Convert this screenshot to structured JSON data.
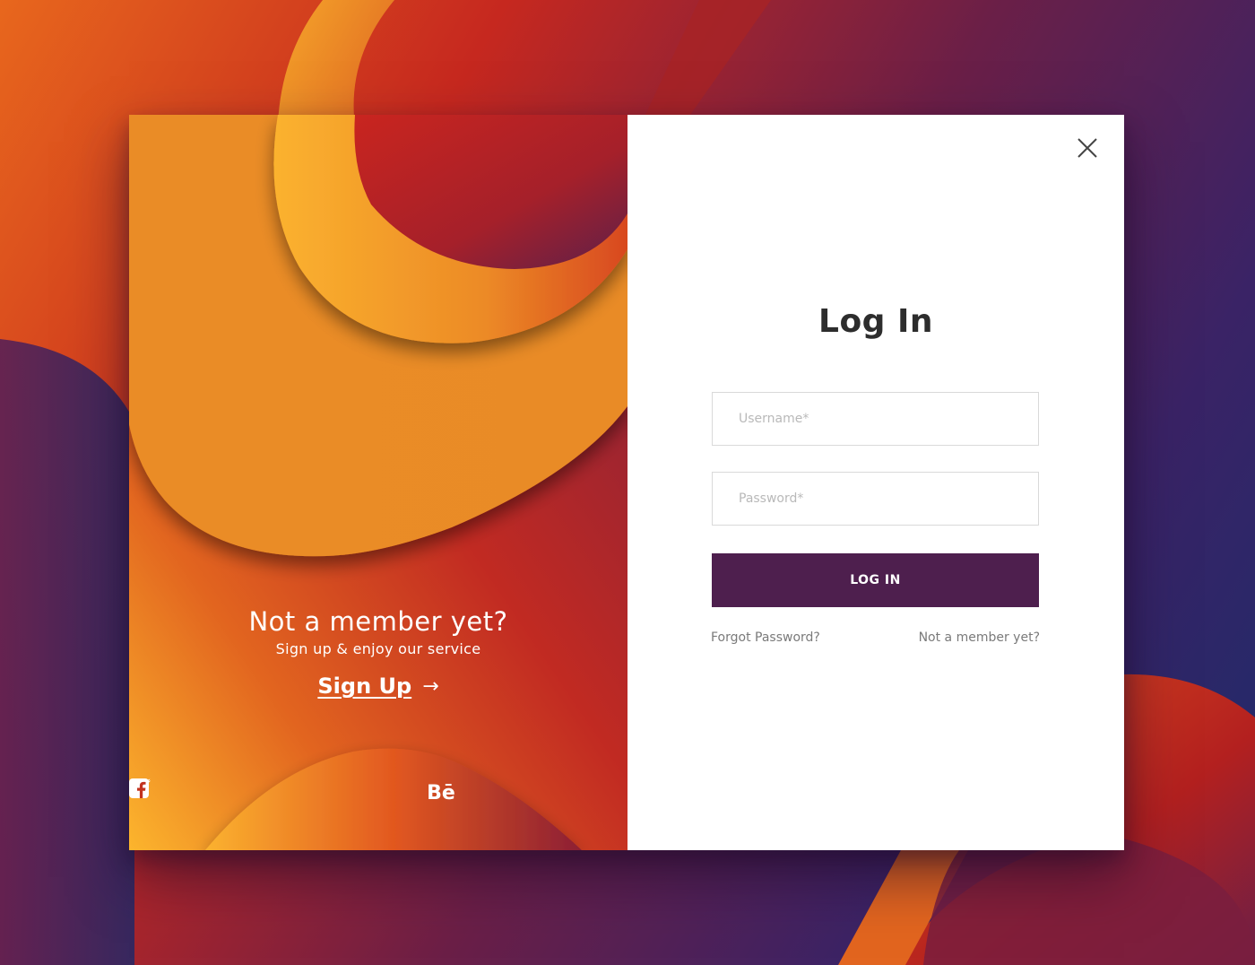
{
  "colors": {
    "accent": "#4e1f4e",
    "orange": "#e98b25",
    "red": "#c6281f",
    "navy": "#1b2c6b",
    "title_text": "#2d2d2d",
    "muted_text": "#7a7a7a"
  },
  "promo": {
    "title": "Not a member yet?",
    "subtitle": "Sign up & enjoy our service",
    "signup_label": "Sign Up",
    "signup_arrow": "→"
  },
  "socials": [
    {
      "icon": "twitter-icon"
    },
    {
      "icon": "facebook-icon"
    },
    {
      "icon": "behance-icon",
      "label": "Bē"
    }
  ],
  "login": {
    "close_icon": "close-icon",
    "title": "Log In",
    "username_placeholder": "Username*",
    "password_placeholder": "Password*",
    "button_label": "LOG IN",
    "forgot_label": "Forgot Password?",
    "member_label": "Not a member yet?"
  }
}
